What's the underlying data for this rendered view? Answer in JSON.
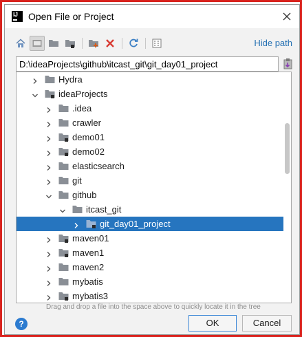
{
  "window": {
    "app_icon_text": "IJ",
    "title": "Open File or Project"
  },
  "toolbar": {
    "buttons": [
      {
        "name": "home-icon"
      },
      {
        "name": "desktop-icon"
      },
      {
        "name": "project-folder-icon"
      },
      {
        "name": "module-folder-icon"
      },
      {
        "name": "new-folder-icon"
      },
      {
        "name": "delete-icon"
      },
      {
        "name": "refresh-icon"
      },
      {
        "name": "show-hidden-icon"
      }
    ],
    "hide_path_label": "Hide path"
  },
  "path": {
    "value": "D:\\ideaProjects\\github\\itcast_git\\git_day01_project"
  },
  "tree": {
    "items": [
      {
        "label": "Hydra",
        "level": 1,
        "expanded": false,
        "module": false,
        "selected": false
      },
      {
        "label": "ideaProjects",
        "level": 1,
        "expanded": true,
        "module": true,
        "selected": false
      },
      {
        "label": ".idea",
        "level": 2,
        "expanded": false,
        "module": false,
        "selected": false
      },
      {
        "label": "crawler",
        "level": 2,
        "expanded": false,
        "module": false,
        "selected": false
      },
      {
        "label": "demo01",
        "level": 2,
        "expanded": false,
        "module": true,
        "selected": false
      },
      {
        "label": "demo02",
        "level": 2,
        "expanded": false,
        "module": true,
        "selected": false
      },
      {
        "label": "elasticsearch",
        "level": 2,
        "expanded": false,
        "module": false,
        "selected": false
      },
      {
        "label": "git",
        "level": 2,
        "expanded": false,
        "module": false,
        "selected": false
      },
      {
        "label": "github",
        "level": 2,
        "expanded": true,
        "module": false,
        "selected": false
      },
      {
        "label": "itcast_git",
        "level": 3,
        "expanded": true,
        "module": false,
        "selected": false
      },
      {
        "label": "git_day01_project",
        "level": 4,
        "expanded": false,
        "module": true,
        "selected": true
      },
      {
        "label": "maven01",
        "level": 2,
        "expanded": false,
        "module": true,
        "selected": false
      },
      {
        "label": "maven1",
        "level": 2,
        "expanded": false,
        "module": true,
        "selected": false
      },
      {
        "label": "maven2",
        "level": 2,
        "expanded": false,
        "module": false,
        "selected": false
      },
      {
        "label": "mybatis",
        "level": 2,
        "expanded": false,
        "module": false,
        "selected": false
      },
      {
        "label": "mybatis3",
        "level": 2,
        "expanded": false,
        "module": true,
        "selected": false
      }
    ]
  },
  "hint": "Drag and drop a file into the space above to quickly locate it in the tree",
  "footer": {
    "help_label": "?",
    "ok_label": "OK",
    "cancel_label": "Cancel"
  },
  "colors": {
    "selection": "#2675bf",
    "link": "#2470b3",
    "folder": "#8a8f96",
    "frame_border": "#d9231e"
  }
}
